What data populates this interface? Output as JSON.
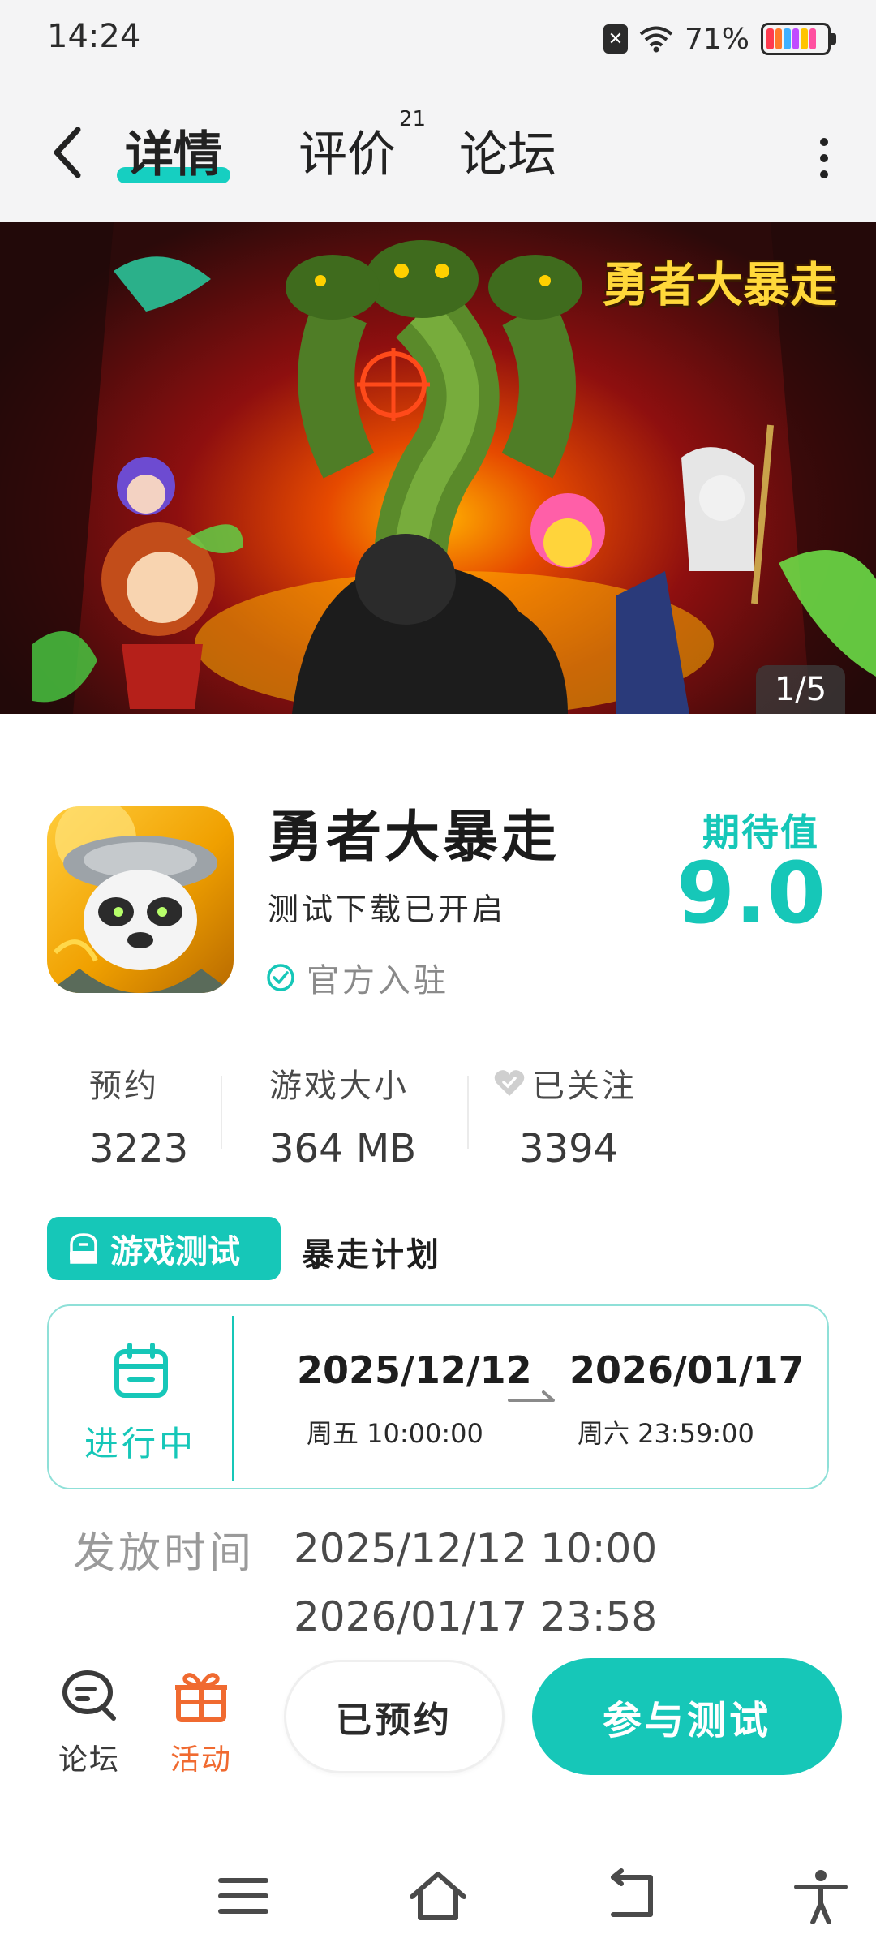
{
  "status_bar": {
    "time": "14:24",
    "battery_percent": "71%"
  },
  "header": {
    "tabs": [
      {
        "label": "详情",
        "active": true
      },
      {
        "label": "评价",
        "badge": "21"
      },
      {
        "label": "论坛"
      }
    ]
  },
  "banner": {
    "logo_text": "勇者大暴走",
    "page_indicator": "1/5"
  },
  "game": {
    "name": "勇者大暴走",
    "subtitle": "测试下载已开启",
    "official_label": "官方入驻",
    "expect_label": "期待值",
    "expect_value": "9.0"
  },
  "stats": [
    {
      "label": "预约",
      "value": "3223"
    },
    {
      "label": "游戏大小",
      "value": "364 MB"
    },
    {
      "label": "已关注",
      "value": "3394"
    }
  ],
  "test": {
    "badge_label": "游戏测试",
    "plan_label": "暴走计划",
    "status": "进行中",
    "start_date": "2025/12/12",
    "start_sub": "周五  10:00:00",
    "end_date": "2026/01/17",
    "end_sub": "周六  23:59:00"
  },
  "release": {
    "label": "发放时间",
    "times": [
      "2025/12/12 10:00",
      "2026/01/17 23:58"
    ]
  },
  "action_bar": {
    "forum_label": "论坛",
    "activity_label": "活动",
    "reserved_label": "已预约",
    "join_label": "参与测试"
  },
  "colors": {
    "accent": "#16c7b8",
    "activity": "#f06a30"
  }
}
